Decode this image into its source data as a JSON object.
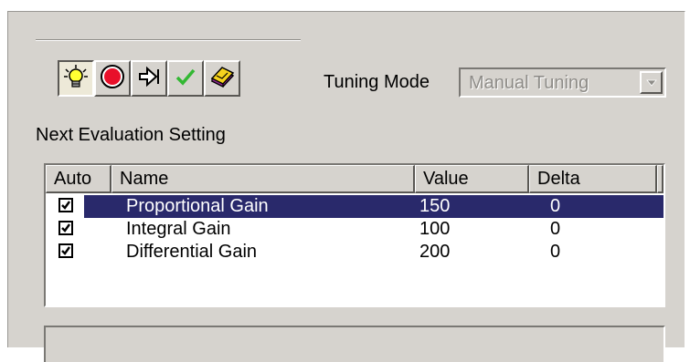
{
  "toolbar": {
    "buttons": [
      {
        "icon": "lightbulb-icon",
        "pressed": true
      },
      {
        "icon": "record-stop-icon",
        "pressed": false
      },
      {
        "icon": "step-arrow-icon",
        "pressed": false
      },
      {
        "icon": "checkmark-icon",
        "pressed": false
      },
      {
        "icon": "book-icon",
        "pressed": false
      }
    ]
  },
  "tuning_mode": {
    "label": "Tuning Mode",
    "value": "Manual Tuning"
  },
  "section_label": "Next Evaluation Setting",
  "table": {
    "headers": [
      "Auto",
      "Name",
      "Value",
      "Delta"
    ],
    "rows": [
      {
        "auto": true,
        "name": "Proportional Gain",
        "value": "150",
        "delta": "0",
        "selected": true
      },
      {
        "auto": true,
        "name": "Integral Gain",
        "value": "100",
        "delta": "0",
        "selected": false
      },
      {
        "auto": true,
        "name": "Differential Gain",
        "value": "200",
        "delta": "0",
        "selected": false
      }
    ]
  },
  "colors": {
    "face": "#d6d3ce",
    "selection": "#29296b",
    "disabled_text": "#8e8c88"
  }
}
